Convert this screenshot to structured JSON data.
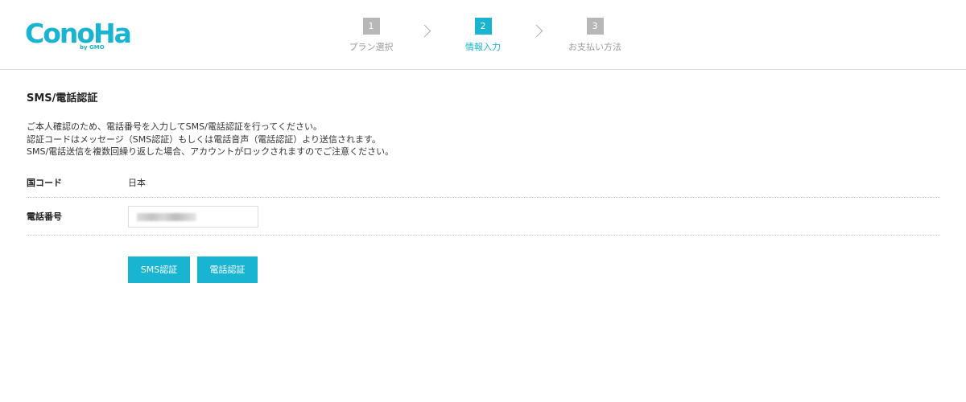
{
  "header": {
    "logo_text": "ConoHa",
    "logo_sub": "by GMO",
    "steps": [
      {
        "number": "1",
        "label": "プラン選択",
        "active": false
      },
      {
        "number": "2",
        "label": "情報入力",
        "active": true
      },
      {
        "number": "3",
        "label": "お支払い方法",
        "active": false
      }
    ]
  },
  "main": {
    "section_title": "SMS/電話認証",
    "description": [
      "ご本人確認のため、電話番号を入力してSMS/電話認証を行ってください。",
      "認証コードはメッセージ（SMS認証）もしくは電話音声（電話認証）より送信されます。",
      "SMS/電話送信を複数回繰り返した場合、アカウントがロックされますのでご注意ください。"
    ],
    "country_code": {
      "label": "国コード",
      "value": "日本"
    },
    "phone": {
      "label": "電話番号",
      "value": ""
    },
    "buttons": {
      "sms": "SMS認証",
      "voice": "電話認証"
    }
  },
  "colors": {
    "accent": "#19b4d2",
    "step_inactive": "#b7b7b7",
    "divider": "#dcdcdc"
  },
  "icons": [
    "chevron-right-icon",
    "chevron-right-icon"
  ]
}
